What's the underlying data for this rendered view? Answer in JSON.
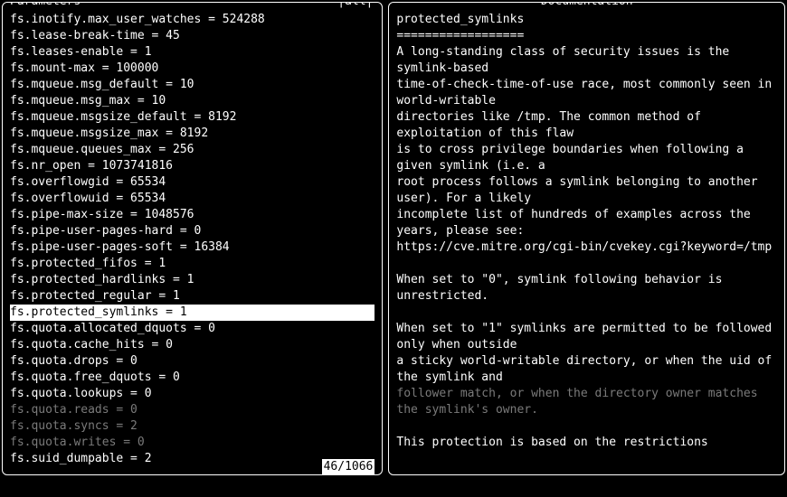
{
  "left": {
    "title": "Parameters",
    "filter_tag": "|all|",
    "counter": "46/1066",
    "selected_index": 18,
    "dim_start_index": 24,
    "dim_end_index": 26,
    "rows": [
      "fs.inotify.max_user_watches = 524288",
      "fs.lease-break-time = 45",
      "fs.leases-enable = 1",
      "fs.mount-max = 100000",
      "fs.mqueue.msg_default = 10",
      "fs.mqueue.msg_max = 10",
      "fs.mqueue.msgsize_default = 8192",
      "fs.mqueue.msgsize_max = 8192",
      "fs.mqueue.queues_max = 256",
      "fs.nr_open = 1073741816",
      "fs.overflowgid = 65534",
      "fs.overflowuid = 65534",
      "fs.pipe-max-size = 1048576",
      "fs.pipe-user-pages-hard = 0",
      "fs.pipe-user-pages-soft = 16384",
      "fs.protected_fifos = 1",
      "fs.protected_hardlinks = 1",
      "fs.protected_regular = 1",
      "fs.protected_symlinks = 1",
      "fs.quota.allocated_dquots = 0",
      "fs.quota.cache_hits = 0",
      "fs.quota.drops = 0",
      "fs.quota.free_dquots = 0",
      "fs.quota.lookups = 0",
      "fs.quota.reads = 0",
      "fs.quota.syncs = 2",
      "fs.quota.writes = 0",
      "fs.suid_dumpable = 2"
    ]
  },
  "right": {
    "title": "Documentation",
    "dim_line_start": 19,
    "dim_line_end": 20,
    "lines": [
      "protected_symlinks",
      "==================",
      "A long-standing class of security issues is the symlink-based",
      "time-of-check-time-of-use race, most commonly seen in world-writable",
      "directories like /tmp. The common method of exploitation of this flaw",
      "is to cross privilege boundaries when following a given symlink (i.e. a",
      "root process follows a symlink belonging to another user). For a likely",
      "incomplete list of hundreds of examples across the years, please see:",
      "https://cve.mitre.org/cgi-bin/cvekey.cgi?keyword=/tmp",
      "",
      "When set to \"0\", symlink following behavior is unrestricted.",
      "",
      "When set to \"1\" symlinks are permitted to be followed only when outside",
      "a sticky world-writable directory, or when the uid of the symlink and",
      "follower match, or when the directory owner matches the symlink's owner.",
      "",
      "This protection is based on the restrictions"
    ],
    "dim_phrases": [
      "follower match, or when the directory owner matches the symlink's owner."
    ]
  }
}
